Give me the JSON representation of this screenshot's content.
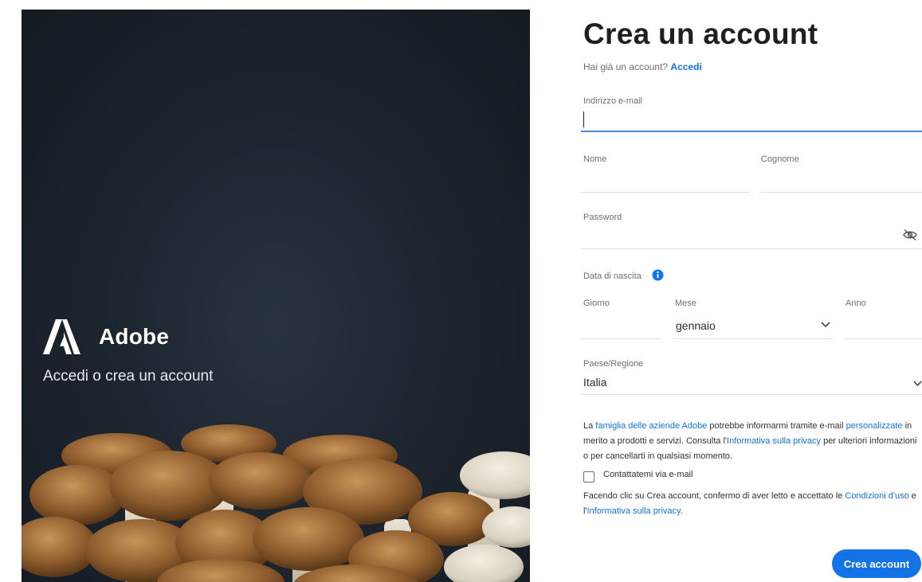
{
  "hero": {
    "brand_name": "Adobe",
    "tagline": "Accedi o crea un account"
  },
  "form": {
    "title": "Crea un account",
    "have_account": "Hai già un account?",
    "signin_link": "Accedi",
    "email_label": "Indirizzo e-mail",
    "email_value": "",
    "first_name_label": "Nome",
    "last_name_label": "Cognome",
    "password_label": "Password",
    "birthdate_label": "Data di nascita",
    "day_label": "Giorno",
    "month_label": "Mese",
    "month_value": "gennaio",
    "year_label": "Anno",
    "country_label": "Paese/Regione",
    "country_value": "Italia",
    "consent": {
      "p1": "La ",
      "link_family": "famiglia delle aziende Adobe",
      "p2": " potrebbe informarmi tramite e-mail ",
      "link_personalized": "personalizzate",
      "p3": " in merito a prodotti e servizi. Consulta l'",
      "link_privacy": "Informativa sulla privacy",
      "p4": " per ulteriori informazioni o per cancellarti in qualsiasi momento."
    },
    "contact_checkbox_label": "Contattatemi via e-mail",
    "contact_checked": false,
    "terms": {
      "p1": "Facendo clic su Crea account, confermo di aver letto e accettato le ",
      "link_terms": "Condizioni d'uso",
      "p2": " e l'",
      "link_privacy": "Informativa sulla privacy",
      "p3": "."
    },
    "submit_label": "Crea account"
  },
  "colors": {
    "accent": "#1473e6",
    "hero_bg": "#1d252f"
  },
  "icons": [
    "adobe-logo",
    "eye-slash-icon",
    "info-icon",
    "chevron-down-icon"
  ]
}
